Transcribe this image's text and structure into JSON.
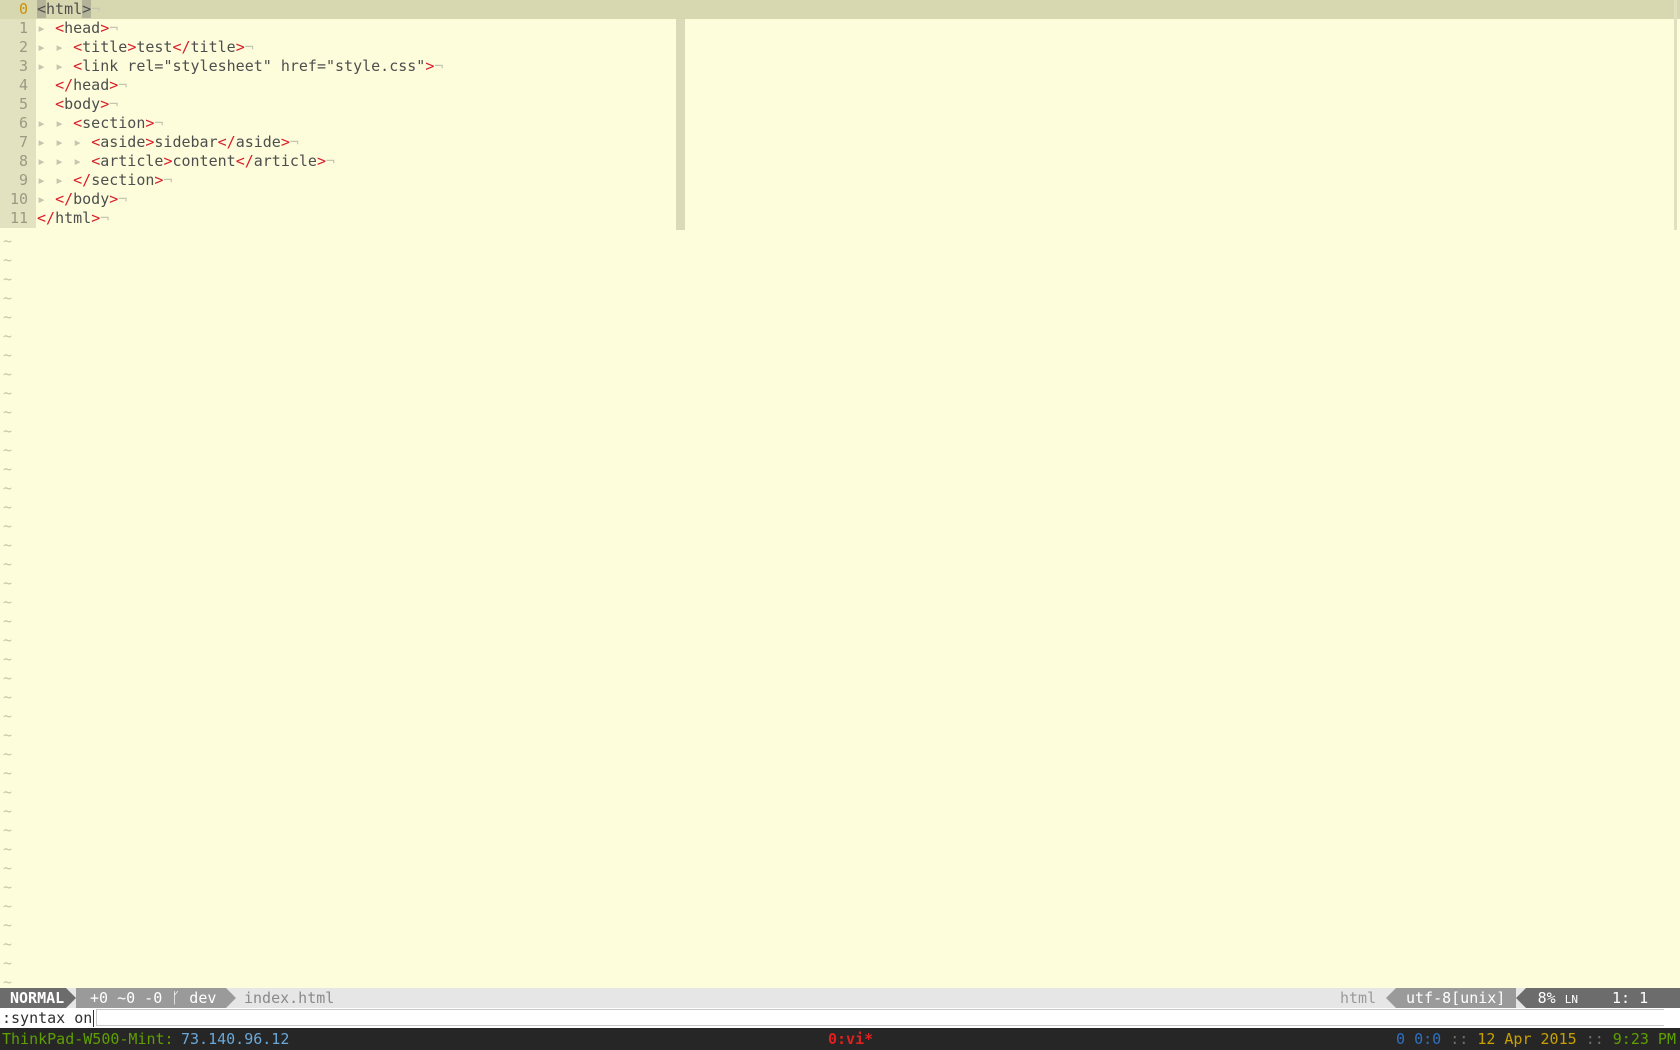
{
  "editor": {
    "lines": [
      {
        "num": "0",
        "indent": "",
        "parts": [
          [
            "cur",
            "<"
          ],
          [
            "name",
            "html"
          ],
          [
            "cur",
            ">"
          ]
        ],
        "eol": "¬"
      },
      {
        "num": "1",
        "indent": "▸ ",
        "parts": [
          [
            "tag",
            "<"
          ],
          [
            "name",
            "head"
          ],
          [
            "tag",
            ">"
          ]
        ],
        "eol": "¬"
      },
      {
        "num": "2",
        "indent": "▸ ▸ ",
        "parts": [
          [
            "tag",
            "<"
          ],
          [
            "name",
            "title"
          ],
          [
            "tag",
            ">"
          ],
          [
            "name",
            "test"
          ],
          [
            "tag",
            "</"
          ],
          [
            "name",
            "title"
          ],
          [
            "tag",
            ">"
          ]
        ],
        "eol": "¬"
      },
      {
        "num": "3",
        "indent": "▸ ▸ ",
        "parts": [
          [
            "tag",
            "<"
          ],
          [
            "name",
            "link rel="
          ],
          [
            "str",
            "\"stylesheet\""
          ],
          [
            "name",
            " href="
          ],
          [
            "str",
            "\"style.css\""
          ],
          [
            "tag",
            ">"
          ]
        ],
        "eol": "¬"
      },
      {
        "num": "4",
        "indent": "",
        "parts": [
          [
            "tag",
            "</"
          ],
          [
            "name",
            "head"
          ],
          [
            "tag",
            ">"
          ]
        ],
        "eol": "¬",
        "lead": "  "
      },
      {
        "num": "5",
        "indent": "",
        "parts": [
          [
            "tag",
            "<"
          ],
          [
            "name",
            "body"
          ],
          [
            "tag",
            ">"
          ]
        ],
        "eol": "¬",
        "lead": "  "
      },
      {
        "num": "6",
        "indent": "▸ ▸ ",
        "parts": [
          [
            "tag",
            "<"
          ],
          [
            "name",
            "section"
          ],
          [
            "tag",
            ">"
          ]
        ],
        "eol": "¬"
      },
      {
        "num": "7",
        "indent": "▸ ▸ ▸ ",
        "parts": [
          [
            "tag",
            "<"
          ],
          [
            "name",
            "aside"
          ],
          [
            "tag",
            ">"
          ],
          [
            "name",
            "sidebar"
          ],
          [
            "tag",
            "</"
          ],
          [
            "name",
            "aside"
          ],
          [
            "tag",
            ">"
          ]
        ],
        "eol": "¬"
      },
      {
        "num": "8",
        "indent": "▸ ▸ ▸ ",
        "parts": [
          [
            "tag",
            "<"
          ],
          [
            "name",
            "article"
          ],
          [
            "tag",
            ">"
          ],
          [
            "name",
            "content"
          ],
          [
            "tag",
            "</"
          ],
          [
            "name",
            "article"
          ],
          [
            "tag",
            ">"
          ]
        ],
        "eol": "¬"
      },
      {
        "num": "9",
        "indent": "▸ ▸ ",
        "parts": [
          [
            "tag",
            "</"
          ],
          [
            "name",
            "section"
          ],
          [
            "tag",
            ">"
          ]
        ],
        "eol": "¬"
      },
      {
        "num": "10",
        "indent": "▸ ",
        "parts": [
          [
            "tag",
            "</"
          ],
          [
            "name",
            "body"
          ],
          [
            "tag",
            ">"
          ]
        ],
        "eol": "¬"
      },
      {
        "num": "11",
        "indent": "",
        "parts": [
          [
            "tag",
            "</"
          ],
          [
            "name",
            "html"
          ],
          [
            "tag",
            ">"
          ]
        ],
        "eol": "¬"
      }
    ],
    "tilde": "~",
    "tilde_count": 40
  },
  "statusline": {
    "mode": "NORMAL",
    "git": "+0 ~0 -0 ᚴ dev",
    "filename": "index.html",
    "filetype": "html",
    "encoding": "utf-8[unix]",
    "percent": "8%",
    "line_symbol": "LN",
    "position": "1:  1"
  },
  "cmdline": {
    "text": ":syntax on"
  },
  "tmux": {
    "host": "ThinkPad-W500-Mint:",
    "ip": "73.140.96.12",
    "window": "0:vi*",
    "status_a": "0",
    "status_b": "0:0",
    "sep": "::",
    "date": "12 Apr 2015",
    "time": "9:23 PM"
  },
  "colors": {
    "background": "#fdfddc",
    "tag": "#d81c2a",
    "cursor_line": "#d8d8b0",
    "tmux_bg": "#262626"
  }
}
